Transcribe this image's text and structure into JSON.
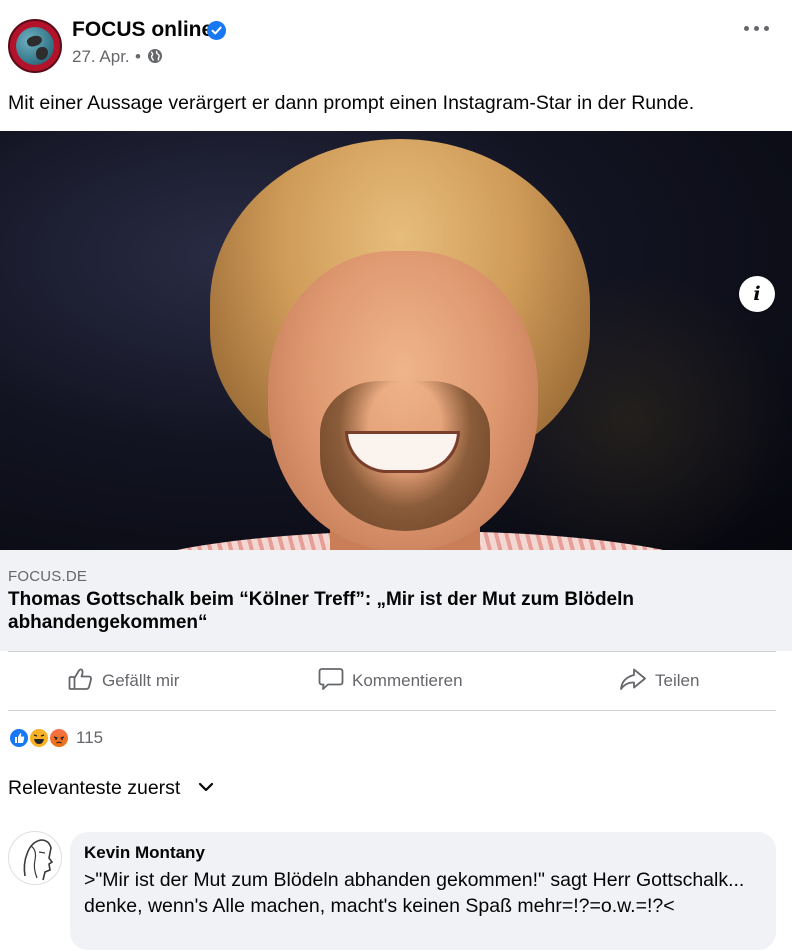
{
  "post": {
    "page_name": "FOCUS online",
    "date": "27. Apr.",
    "separator": "•",
    "audience_icon": "globe-icon",
    "text": "Mit einer Aussage verärgert er dann prompt einen Instagram-Star in der Runde."
  },
  "link_preview": {
    "domain": "FOCUS.DE",
    "title": "Thomas Gottschalk beim “Kölner Treff”: „Mir ist der Mut zum Blödeln abhandengekommen“",
    "info_label": "i"
  },
  "actions": {
    "like": "Gefällt mir",
    "comment": "Kommentieren",
    "share": "Teilen"
  },
  "reactions": {
    "types": [
      "like",
      "haha",
      "angry"
    ],
    "count": "115"
  },
  "comments_sort": {
    "label": "Relevanteste zuerst"
  },
  "comment": {
    "author": "Kevin Montany",
    "text": ">\"Mir ist der Mut zum Blödeln abhanden gekommen!\" sagt Herr Gottschalk... denke, wenn's Alle machen, macht's keinen Spaß mehr=!?=o.w.=!?<"
  },
  "colors": {
    "accent": "#1877f2",
    "secondary_text": "#65676b",
    "link_box_bg": "#f0f2f5",
    "focus_brand": "#b3122b"
  }
}
